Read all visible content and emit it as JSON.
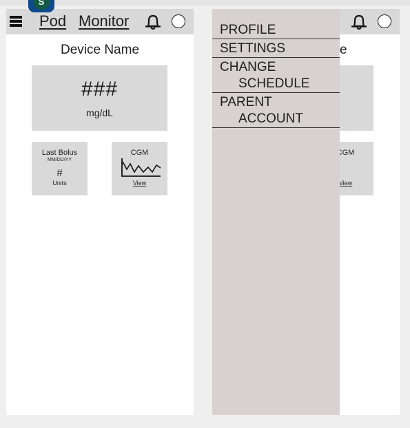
{
  "avatar": {
    "letter": "S"
  },
  "left_screen": {
    "nav": {
      "menu_icon": "hamburger-menu-icon",
      "pod_label": "Pod",
      "monitor_label": "Monitor",
      "bell_icon": "bell-icon",
      "profile_icon": "circle-icon"
    },
    "device_name": "Device Name",
    "glucose": {
      "value": "###",
      "unit": "mg/dL"
    },
    "last_bolus": {
      "title": "Last Bolus",
      "date": "MM/DD/YY",
      "amount": "#",
      "unit": "Units"
    },
    "cgm": {
      "title": "CGM",
      "link": "View",
      "graph_icon": "cgm-trend-graph"
    }
  },
  "right_screen": {
    "drawer": {
      "items": [
        {
          "line1": "PROFILE",
          "line2": ""
        },
        {
          "line1": "SETTINGS",
          "line2": ""
        },
        {
          "line1": "CHANGE",
          "line2": "SCHEDULE"
        },
        {
          "line1": "PARENT",
          "line2": "ACCOUNT"
        }
      ]
    },
    "peek": {
      "device_name_tail": "e",
      "cgm_title_tail": "CGM",
      "view_tail": "View"
    }
  },
  "colors": {
    "nav_bg": "#d8d8d8",
    "card_bg": "#d9d9d9",
    "drawer_bg": "#d8d1d1",
    "avatar_outer": "#0f4a8c",
    "avatar_inner": "#145a43"
  }
}
